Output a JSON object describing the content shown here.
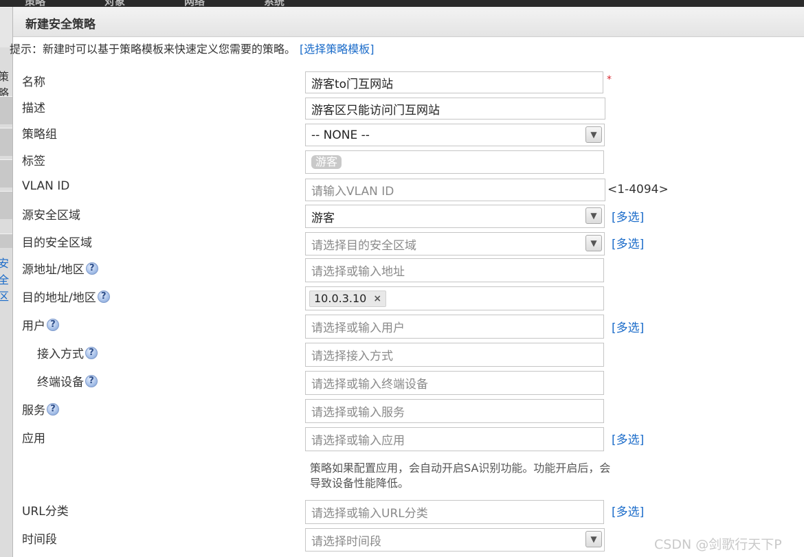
{
  "background": {
    "topbar_items": [
      "策略",
      "对象",
      "网络",
      "系统"
    ],
    "left_fragments": [
      "策略",
      "安全区"
    ]
  },
  "dialog": {
    "title": "新建安全策略",
    "tip_text": "提示：新建时可以基于策略模板来快速定义您需要的策略。",
    "tip_link": "[选择策略模板]"
  },
  "form": {
    "name": {
      "label": "名称",
      "value": "游客to门互网站",
      "required_mark": "*"
    },
    "description": {
      "label": "描述",
      "value": "游客区只能访问门互网站"
    },
    "policy_group": {
      "label": "策略组",
      "value": "-- NONE --"
    },
    "tags": {
      "label": "标签",
      "tag": "游客"
    },
    "vlan_id": {
      "label": "VLAN ID",
      "placeholder": "请输入VLAN ID",
      "range": "<1-4094>"
    },
    "src_zone": {
      "label": "源安全区域",
      "value": "游客",
      "multi": "[多选]"
    },
    "dst_zone": {
      "label": "目的安全区域",
      "placeholder": "请选择目的安全区域",
      "multi": "[多选]"
    },
    "src_addr": {
      "label": "源地址/地区",
      "placeholder": "请选择或输入地址"
    },
    "dst_addr": {
      "label": "目的地址/地区",
      "chip": "10.0.3.10",
      "chip_remove": "×"
    },
    "user": {
      "label": "用户",
      "placeholder": "请选择或输入用户",
      "multi": "[多选]"
    },
    "access_mode": {
      "label": "接入方式",
      "placeholder": "请选择接入方式"
    },
    "terminal": {
      "label": "终端设备",
      "placeholder": "请选择或输入终端设备"
    },
    "service": {
      "label": "服务",
      "placeholder": "请选择或输入服务"
    },
    "application": {
      "label": "应用",
      "placeholder": "请选择或输入应用",
      "multi": "[多选]",
      "note": "策略如果配置应用，会自动开启SA识别功能。功能开启后，会导致设备性能降低。"
    },
    "url_category": {
      "label": "URL分类",
      "placeholder": "请选择或输入URL分类",
      "multi": "[多选]"
    },
    "time_range": {
      "label": "时间段",
      "placeholder": "请选择时间段"
    }
  },
  "help_glyph": "?",
  "dropdown_glyph": "▼",
  "watermark": "CSDN @剑歌行天下P"
}
